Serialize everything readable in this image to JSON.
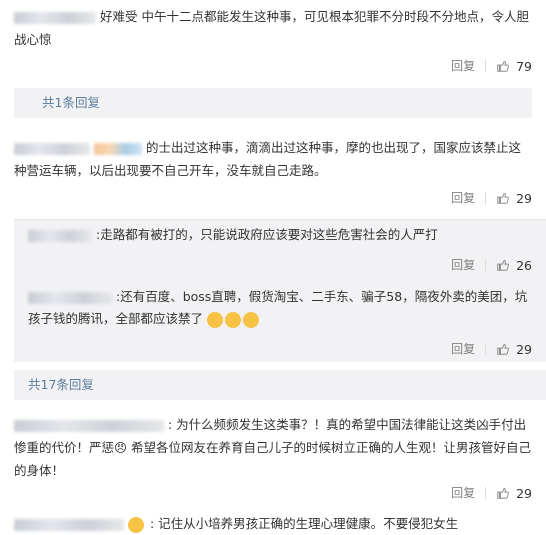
{
  "comments": [
    {
      "id": "c1",
      "text": "好难受 中午十二点都能发生这种事，可见根本犯罪不分时段不分地点，令人胆战心惊",
      "reply_label": "回复",
      "like_count": "79",
      "more_replies": "共1条回复"
    },
    {
      "id": "c2",
      "text": "的士出过这种事，滴滴出过这种事，摩的也出现了，国家应该禁止这种营运车辆，以后出现要不自己开车，没车就自己走路。",
      "reply_label": "回复",
      "like_count": "29",
      "replies": [
        {
          "text": ":走路都有被打的，只能说政府应该要对这些危害社会的人严打",
          "reply_label": "回复",
          "like_count": "26"
        },
        {
          "text": ":还有百度、boss直聘，假货淘宝、二手东、骗子58，隔夜外卖的美团，坑孩子钱的腾讯，全部都应该禁了",
          "reply_label": "回复",
          "like_count": "29"
        }
      ],
      "more_replies": "共17条回复"
    },
    {
      "id": "c3",
      "text": ": 为什么频频发生这类事？！真的希望中国法律能让这类凶手付出惨重的代价！严惩😠 希望各位网友在养育自己儿子的时候树立正确的人生观！让男孩管好自己的身体！",
      "reply_label": "回复",
      "like_count": "29"
    },
    {
      "id": "c4",
      "text": ": 记住从小培养男孩正确的生理心理健康。不要侵犯女生"
    }
  ],
  "icons": {
    "like": "thumbs-up-icon",
    "emoji": "emoji-icon"
  },
  "colors": {
    "link": "#5b7c9c",
    "muted": "#808080",
    "sub_bg": "#f2f2f5"
  }
}
